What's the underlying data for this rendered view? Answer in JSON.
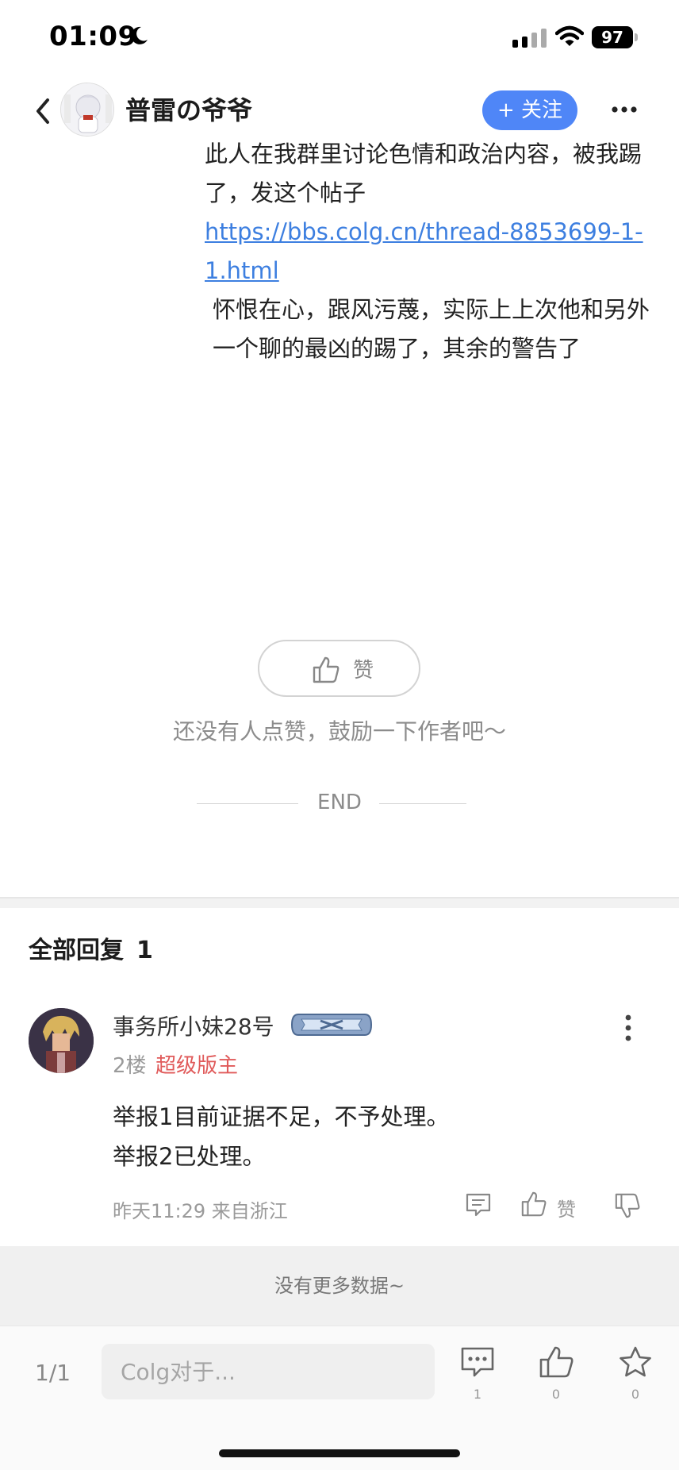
{
  "status_bar": {
    "time": "01:09",
    "battery": "97",
    "icons": [
      "moon-icon",
      "signal-icon",
      "wifi-icon",
      "battery-icon"
    ]
  },
  "header": {
    "author_name": "普雷の爷爷",
    "follow_label": "+ 关注",
    "icons": [
      "back-icon",
      "more-icon"
    ]
  },
  "post": {
    "line1_text": "此人在我群里讨论色情和政治内容，被我踢了，发这个帖子 ",
    "link_text": "https://bbs.colg.cn/thread-8853699-1-1.html",
    "line2_text": "怀恨在心，跟风污蔑，实际上上次他和另外一个聊的最凶的踢了，其余的警告了"
  },
  "like_area": {
    "label": "赞",
    "hint": "还没有人点赞，鼓励一下作者吧～",
    "end_text": "END"
  },
  "replies": {
    "title": "全部回复",
    "count": "1",
    "items": [
      {
        "name": "事务所小妹28号",
        "floor": "2楼",
        "role": "超级版主",
        "body_lines": [
          "举报1目前证据不足，不予处理。",
          "举报2已处理。"
        ],
        "meta": "昨天11:29 来自浙江",
        "like_label": "赞"
      }
    ]
  },
  "no_more_text": "没有更多数据~",
  "bottom_bar": {
    "page": "1/1",
    "input_placeholder": "Colg对于...",
    "comments_count": "1",
    "likes_count": "0",
    "favorites_count": "0"
  },
  "colors": {
    "accent": "#4f86f7",
    "link": "#3d7fe0",
    "role": "#e05a5a"
  }
}
